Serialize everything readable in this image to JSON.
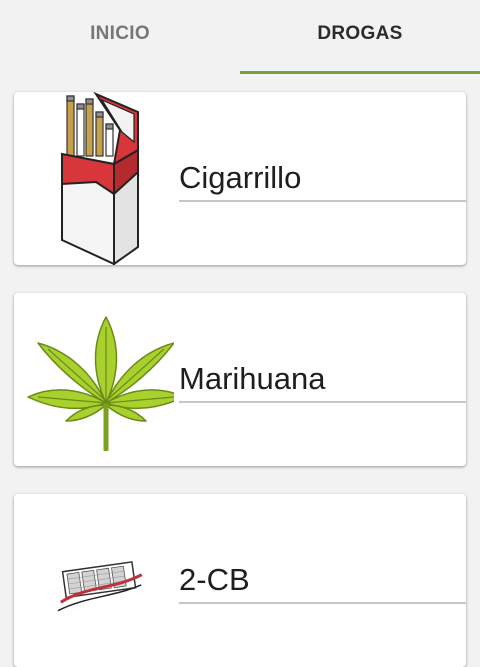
{
  "tabs": [
    {
      "label": "INICIO"
    },
    {
      "label": "DROGAS"
    }
  ],
  "active_tab": "DROGAS",
  "accent_color": "#6fa342",
  "drugs": [
    {
      "name": "Cigarrillo",
      "icon": "cigarette-pack-icon"
    },
    {
      "name": "Marihuana",
      "icon": "cannabis-leaf-icon"
    },
    {
      "name": "2-CB",
      "icon": "pill-strip-icon"
    }
  ]
}
